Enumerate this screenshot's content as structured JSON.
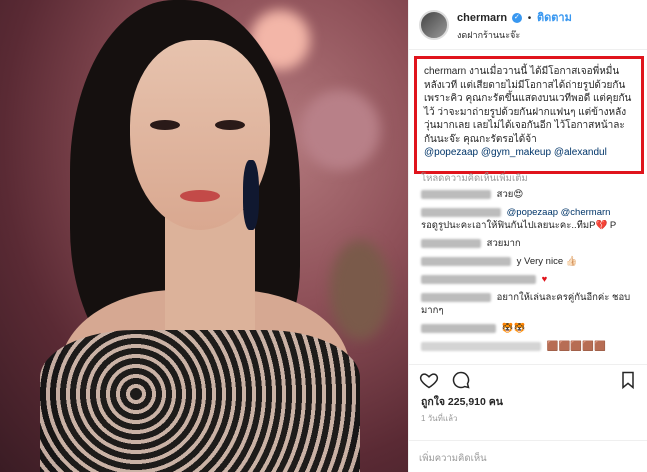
{
  "header": {
    "username": "chermarn",
    "follow_label": "ติดตาม",
    "location": "งดฝากร้านนะจ๊ะ"
  },
  "caption": {
    "username": "chermarn",
    "text": "งานเมื่อวานนี้ ได้มีโอกาสเจอพี่หมื่นหลังเวที แต่เสียดายไม่มีโอกาสได้ถ่ายรูปด้วยกัน เพราะคิว คุณกะรัตขึ้นแสดงบนเวทีพอดี แต่คุยกันไว้ ว่าจะมาถ่ายรูปด้วยกันฝากแฟนๆ แต่ข้างหลังวุ่นมากเลย เลยไม่ได้เจอกันอีก ไว้โอกาสหน้าละกันนะจ๊ะ คุณกะรัตรอได้จ้า",
    "tags": [
      "@popezaap",
      "@gym_makeup",
      "@alexandul"
    ]
  },
  "comments": {
    "load_more": "โหลดความคิดเห็นเพิ่มเติม",
    "items": [
      {
        "text": "สวย😍"
      },
      {
        "text": "@popezaap @chermarn",
        "line2": "รอดูรูปนะคะเอาให้ฟินกันไปเลยนะคะ..ทีมP💔 P"
      },
      {
        "text": "สวยมาก"
      },
      {
        "text": "y Very nice 👍🏻"
      },
      {
        "text": "♥"
      },
      {
        "text": "อยากให้เล่นละครคู่กันอีกค่ะ ชอบ",
        "line2": "มากๆ"
      },
      {
        "text": "🐯🐯"
      },
      {
        "text": "🟫🟫🟫🟫🟫"
      }
    ]
  },
  "likes": "ถูกใจ 225,910 คน",
  "time": "1 วันที่แล้ว",
  "add_comment_placeholder": "เพิ่มความคิดเห็น",
  "icons": [
    "heart-icon",
    "comment-icon",
    "bookmark-icon"
  ],
  "colors": {
    "accent": "#3897f0",
    "highlight_border": "#e0141c"
  }
}
